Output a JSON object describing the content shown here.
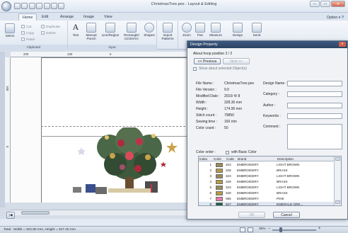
{
  "app": {
    "title": "ChristmasTree.pes - Layout & Editing",
    "option_label": "Option",
    "help_label": "?",
    "tabs": [
      "Home",
      "Edit",
      "Arrange",
      "Image",
      "View"
    ],
    "active_tab": "Home"
  },
  "ribbon": {
    "clipboard": {
      "label": "Clipboard",
      "select_label": "Select",
      "cut_label": "Cut",
      "copy_label": "Copy",
      "paste_label": "Paste",
      "duplicate_label": "Duplicate",
      "delete_label": "Delete"
    },
    "input": {
      "label": "Input",
      "buttons": [
        "Text",
        "Manual Punch",
        "Line/Region",
        "Rectangle/ Circle/Arc",
        "Shapes"
      ]
    },
    "import": {
      "label": "Import Patterns"
    },
    "view_buttons": [
      "Zoom",
      "Pan",
      "Measure",
      "Design",
      "Send"
    ]
  },
  "rulers": {
    "top": [
      "200",
      "100",
      "0"
    ],
    "left": [
      "100",
      "0"
    ]
  },
  "status": {
    "text": "Total : Width = 322.80 mm, Height = 347.40 mm",
    "zoom": "30%"
  },
  "dialog": {
    "title": "Design Property",
    "close_label": "x",
    "hoop_position": "About hoop position 2 / 2",
    "previous_label": "<< Previous",
    "next_label": "Next >>",
    "show_selected_label": "Show about selected Object(s)",
    "info": [
      {
        "label": "File Name :",
        "value": "ChristmasTree.pes"
      },
      {
        "label": "File Version :",
        "value": "9.0"
      },
      {
        "label": "Modified Date :",
        "value": "2010/ 4/ 8"
      },
      {
        "label": "Width :",
        "value": "328.30 mm"
      },
      {
        "label": "Height :",
        "value": "174.90 mm"
      },
      {
        "label": "Stitch count :",
        "value": "79850"
      },
      {
        "label": "Sewing time :",
        "value": "160 min"
      },
      {
        "label": "Color count :",
        "value": "50"
      }
    ],
    "design_fields": [
      {
        "label": "Design Name :",
        "value": ""
      },
      {
        "label": "Category :",
        "value": ""
      },
      {
        "label": "Author :",
        "value": ""
      },
      {
        "label": "Keywords :",
        "value": ""
      },
      {
        "label": "Comment :",
        "value": ""
      }
    ],
    "color_order_label": "Color order :",
    "basic_color_label": "with Basic Color",
    "table_headers": [
      "Index",
      "Color",
      "Code",
      "Brand",
      "Description"
    ],
    "rows": [
      {
        "index": "1",
        "color": "#9a8a5c",
        "code": "323",
        "brand": "EMBROIDERY",
        "description": "LIGHT BROWN"
      },
      {
        "index": "2",
        "color": "#b59a47",
        "code": "328",
        "brand": "EMBROIDERY",
        "description": "BRASS"
      },
      {
        "index": "3",
        "color": "#9a8a5c",
        "code": "323",
        "brand": "EMBROIDERY",
        "description": "LIGHT BROWN"
      },
      {
        "index": "4",
        "color": "#b59a47",
        "code": "328",
        "brand": "EMBROIDERY",
        "description": "BRASS"
      },
      {
        "index": "5",
        "color": "#9a8a5c",
        "code": "323",
        "brand": "EMBROIDERY",
        "description": "LIGHT BROWN"
      },
      {
        "index": "6",
        "color": "#b59a47",
        "code": "328",
        "brand": "EMBROIDERY",
        "description": "BRASS"
      },
      {
        "index": "7",
        "color": "#e87aa0",
        "code": "085",
        "brand": "EMBROIDERY",
        "description": "PINK"
      },
      {
        "index": "8",
        "color": "#1c5f3c",
        "code": "507",
        "brand": "EMBROIDERY",
        "description": "EMERALD GRE..."
      }
    ],
    "ok_label": "OK",
    "cancel_label": "Cancel"
  },
  "colors": {
    "accent": "#2b4364",
    "ribbon": "#dfe7f1"
  }
}
